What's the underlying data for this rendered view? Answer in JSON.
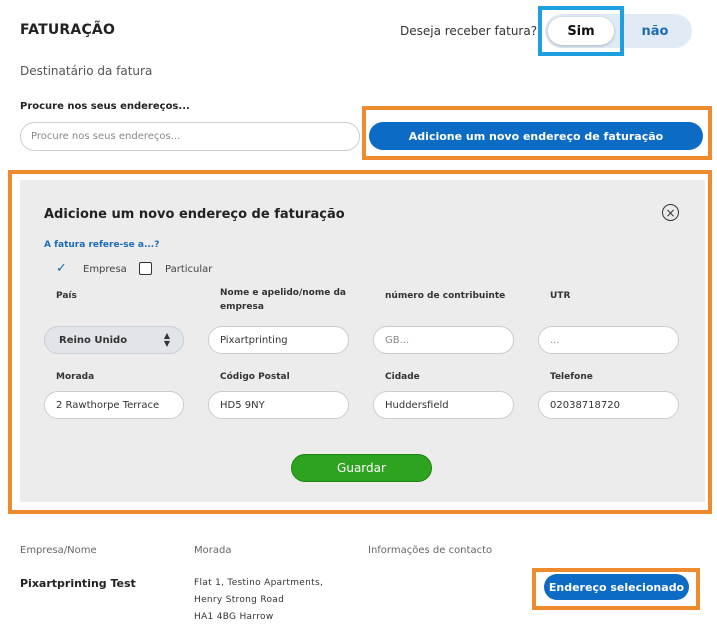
{
  "header": {
    "title": "FATURAÇÃO",
    "question": "Deseja receber fatura?",
    "toggle": {
      "yes_label": "Sim",
      "no_label": "não",
      "selected": "Sim"
    }
  },
  "recipient_label": "Destinatário da fatura",
  "search": {
    "label": "Procure nos seus endereços...",
    "placeholder": "Procure nos seus endereços..."
  },
  "add_button_label": "Adicione um novo endereço de faturação",
  "form": {
    "title": "Adicione um novo endereço de faturação",
    "close_icon": "close-icon",
    "refers_to_label": "A fatura refere-se a...?",
    "options": [
      {
        "label": "Empresa",
        "checked": true
      },
      {
        "label": "Particular",
        "checked": false
      }
    ],
    "fields": {
      "country": {
        "label": "País",
        "value": "Reino Unido"
      },
      "name": {
        "label": "Nome e apelido/nome da empresa",
        "value": "Pixartprinting"
      },
      "tax_number": {
        "label": "número de contribuinte",
        "placeholder": "GB..."
      },
      "utr": {
        "label": "UTR",
        "placeholder": "..."
      },
      "address": {
        "label": "Morada",
        "value": "2 Rawthorpe Terrace"
      },
      "postal_code": {
        "label": "Código Postal",
        "value": "HD5 9NY"
      },
      "city": {
        "label": "Cidade",
        "value": "Huddersfield"
      },
      "phone": {
        "label": "Telefone",
        "value": "02038718720"
      }
    },
    "save_label": "Guardar"
  },
  "selected_address": {
    "columns": [
      "Empresa/Nome",
      "Morada",
      "Informações de contacto"
    ],
    "name": "Pixartprinting Test",
    "address_lines": [
      "Flat 1, Testino Apartments,",
      "Henry Strong Road",
      "HA1 4BG Harrow"
    ],
    "button_label": "Endereço selecionado"
  },
  "colors": {
    "primary": "#0c6bc4",
    "success": "#2ea31f",
    "highlight_orange": "#f08a2e",
    "highlight_blue": "#1e9fe0",
    "panel": "#ececec"
  }
}
